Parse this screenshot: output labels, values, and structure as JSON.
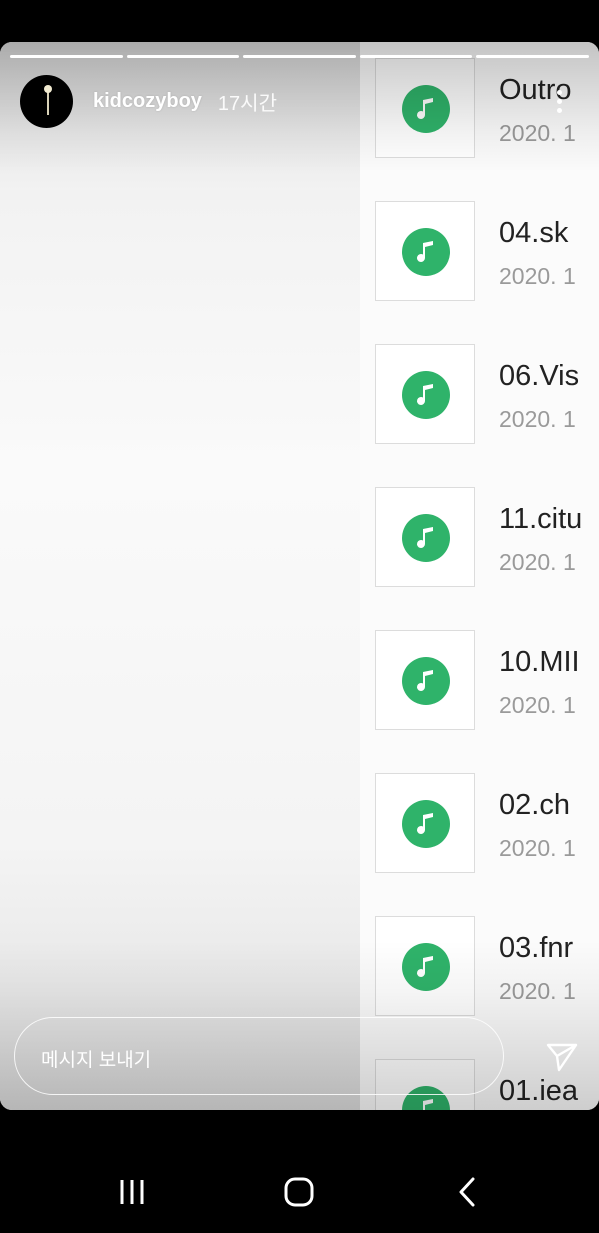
{
  "story": {
    "segments": [
      {
        "done": true
      },
      {
        "done": true
      },
      {
        "done": true
      },
      {
        "done": true
      },
      {
        "done": true
      }
    ],
    "username": "kidcozyboy",
    "time_ago": "17시간"
  },
  "files": [
    {
      "name": "Outro",
      "date": "2020. 1"
    },
    {
      "name": "04.sk",
      "date": "2020. 1"
    },
    {
      "name": "06.Vis",
      "date": "2020. 1"
    },
    {
      "name": "11.citu",
      "date": "2020. 1"
    },
    {
      "name": "10.MII",
      "date": "2020. 1"
    },
    {
      "name": "02.ch",
      "date": "2020. 1"
    },
    {
      "name": "03.fnr",
      "date": "2020. 1"
    },
    {
      "name": "01.iea",
      "date": "2020. 1"
    }
  ],
  "message_bar": {
    "placeholder": "메시지 보내기"
  },
  "icons": {
    "file_icon": "music-note-icon",
    "accent": "#2fb36a",
    "send": "send-icon",
    "more": "more-vertical-icon"
  },
  "navigation": {
    "recents": "recents-icon",
    "home": "home-icon",
    "back": "back-icon"
  }
}
